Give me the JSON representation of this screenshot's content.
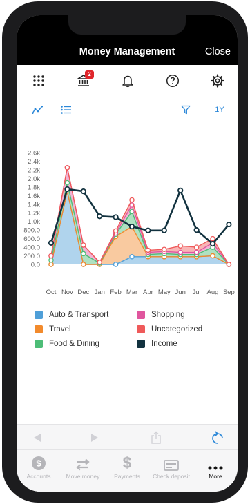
{
  "header": {
    "title": "Money Management",
    "close_label": "Close"
  },
  "toolbar": {
    "icons": [
      "grid-icon",
      "bank-icon",
      "bell-icon",
      "help-icon",
      "gear-icon"
    ],
    "bank_badge": "2"
  },
  "subbar": {
    "range_label": "1Y"
  },
  "chart_data": {
    "type": "area",
    "x": [
      "Oct",
      "Nov",
      "Dec",
      "Jan",
      "Feb",
      "Mar",
      "Apr",
      "May",
      "Jun",
      "Jul",
      "Aug",
      "Sep"
    ],
    "ylim": [
      0,
      2.6
    ],
    "yticks": [
      "0.0",
      "200.0",
      "400.0",
      "600.0",
      "800.0",
      "1.0k",
      "1.2k",
      "1.4k",
      "1.6k",
      "1.8k",
      "2.0k",
      "2.2k",
      "2.4k",
      "2.6k"
    ],
    "series": [
      {
        "name": "Auto & Transport",
        "color": "#4f9fd8",
        "values": [
          0.0,
          1.7,
          0.0,
          0.0,
          0.0,
          0.18,
          0.18,
          0.18,
          0.18,
          0.18,
          0.2,
          0.0
        ]
      },
      {
        "name": "Travel",
        "color": "#f28a2c",
        "values": [
          0.0,
          0.0,
          0.0,
          0.0,
          0.65,
          0.7,
          0.0,
          0.0,
          0.0,
          0.0,
          0.0,
          0.0
        ]
      },
      {
        "name": "Food & Dining",
        "color": "#4dbd77",
        "values": [
          0.1,
          0.2,
          0.25,
          0.03,
          0.05,
          0.35,
          0.05,
          0.07,
          0.05,
          0.05,
          0.2,
          0.0
        ]
      },
      {
        "name": "Shopping",
        "color": "#e0569e",
        "values": [
          0.1,
          0.35,
          0.2,
          0.02,
          0.03,
          0.15,
          0.05,
          0.05,
          0.05,
          0.05,
          0.1,
          0.0
        ]
      },
      {
        "name": "Uncategorized",
        "color": "#ef5a5a",
        "values": [
          0.0,
          0.0,
          0.0,
          0.0,
          0.05,
          0.12,
          0.05,
          0.05,
          0.15,
          0.12,
          0.1,
          0.0
        ]
      }
    ],
    "income": {
      "name": "Income",
      "color": "#12323f",
      "values": [
        0.5,
        1.75,
        1.7,
        1.12,
        1.1,
        0.88,
        0.79,
        0.79,
        1.72,
        0.8,
        0.48,
        0.93
      ]
    }
  },
  "legend": [
    {
      "label": "Auto & Transport",
      "color": "#4f9fd8"
    },
    {
      "label": "Shopping",
      "color": "#e0569e"
    },
    {
      "label": "Travel",
      "color": "#f28a2c"
    },
    {
      "label": "Uncategorized",
      "color": "#ef5a5a"
    },
    {
      "label": "Food & Dining",
      "color": "#4dbd77"
    },
    {
      "label": "Income",
      "color": "#12323f"
    }
  ],
  "tabs": [
    {
      "label": "Accounts",
      "icon": "dollar-circle-icon"
    },
    {
      "label": "Move money",
      "icon": "transfer-arrows-icon"
    },
    {
      "label": "Payments",
      "icon": "dollar-sign-icon"
    },
    {
      "label": "Check deposit",
      "icon": "check-card-icon"
    },
    {
      "label": "More",
      "icon": "more-dots-icon",
      "active": true
    }
  ]
}
